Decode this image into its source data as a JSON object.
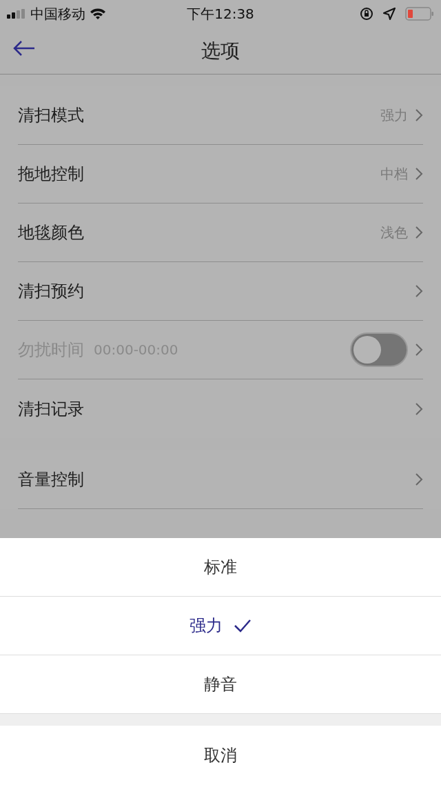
{
  "status_bar": {
    "carrier": "中国移动",
    "time": "下午12:38"
  },
  "title": "选项",
  "sections": [
    {
      "rows": [
        {
          "kind": "value",
          "label": "清扫模式",
          "value": "强力",
          "disabled": false
        },
        {
          "kind": "value",
          "label": "拖地控制",
          "value": "中档",
          "disabled": false
        },
        {
          "kind": "value",
          "label": "地毯颜色",
          "value": "浅色",
          "disabled": false
        },
        {
          "kind": "link",
          "label": "清扫预约",
          "disabled": false
        },
        {
          "kind": "toggle",
          "label": "勿扰时间",
          "detail": "00:00-00:00",
          "on": false,
          "disabled": true
        },
        {
          "kind": "link",
          "label": "清扫记录",
          "disabled": false
        }
      ]
    },
    {
      "rows": [
        {
          "kind": "link",
          "label": "音量控制",
          "disabled": false
        }
      ]
    }
  ],
  "sheet": {
    "options": [
      {
        "label": "标准",
        "selected": false
      },
      {
        "label": "强力",
        "selected": true
      },
      {
        "label": "静音",
        "selected": false
      }
    ],
    "cancel": "取消"
  }
}
